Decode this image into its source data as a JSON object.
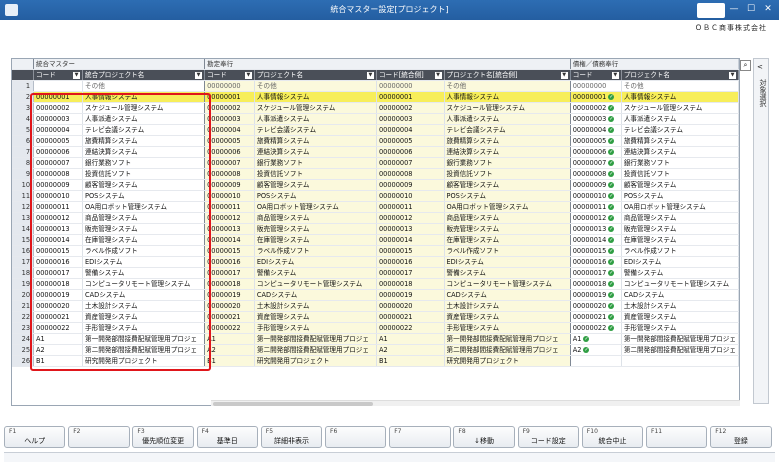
{
  "window": {
    "title": "統合マスター設定[プロジェクト]",
    "company": "ＯＢＣ商事株式会社",
    "min": "—",
    "max": "☐",
    "close": "✕"
  },
  "groups": {
    "g1": "統合マスター",
    "g2": "勘定奉行",
    "g3": "債権／債務奉行"
  },
  "headers": {
    "h1": "コード",
    "h2": "統合プロジェクト名",
    "h3": "コード",
    "h4": "プロジェクト名",
    "h5": "コード[統合側]",
    "h6": "プロジェクト名[統合側]",
    "h7": "コード",
    "h8": "プロジェクト名"
  },
  "side_panel": {
    "label": "対象選択",
    "chevron": "<"
  },
  "search_icon": "search-icon",
  "rows": [
    {
      "n": "1",
      "c": "",
      "name": "その他",
      "c2": "00000000",
      "n2": "その他",
      "c3": "00000000",
      "n3": "その他",
      "c4": "00000000",
      "n4": "その他"
    },
    {
      "n": "2",
      "c": "00000001",
      "name": "人事情報システム",
      "c2": "00000001",
      "n2": "人事情報システム",
      "c3": "00000001",
      "n3": "人事情報システム",
      "c4": "00000001",
      "n4": "人事情報システム"
    },
    {
      "n": "3",
      "c": "00000002",
      "name": "スケジュール管理システム",
      "c2": "00000002",
      "n2": "スケジュール管理システム",
      "c3": "00000002",
      "n3": "スケジュール管理システム",
      "c4": "00000002",
      "n4": "スケジュール管理システム"
    },
    {
      "n": "4",
      "c": "00000003",
      "name": "人事派遣システム",
      "c2": "00000003",
      "n2": "人事派遣システム",
      "c3": "00000003",
      "n3": "人事派遣システム",
      "c4": "00000003",
      "n4": "人事派遣システム"
    },
    {
      "n": "5",
      "c": "00000004",
      "name": "テレビ会議システム",
      "c2": "00000004",
      "n2": "テレビ会議システム",
      "c3": "00000004",
      "n3": "テレビ会議システム",
      "c4": "00000004",
      "n4": "テレビ会議システム"
    },
    {
      "n": "6",
      "c": "00000005",
      "name": "旅費精算システム",
      "c2": "00000005",
      "n2": "旅費精算システム",
      "c3": "00000005",
      "n3": "旅費精算システム",
      "c4": "00000005",
      "n4": "旅費精算システム"
    },
    {
      "n": "7",
      "c": "00000006",
      "name": "連結決算システム",
      "c2": "00000006",
      "n2": "連結決算システム",
      "c3": "00000006",
      "n3": "連結決算システム",
      "c4": "00000006",
      "n4": "連結決算システム"
    },
    {
      "n": "8",
      "c": "00000007",
      "name": "銀行業務ソフト",
      "c2": "00000007",
      "n2": "銀行業務ソフト",
      "c3": "00000007",
      "n3": "銀行業務ソフト",
      "c4": "00000007",
      "n4": "銀行業務ソフト"
    },
    {
      "n": "9",
      "c": "00000008",
      "name": "投資信託ソフト",
      "c2": "00000008",
      "n2": "投資信託ソフト",
      "c3": "00000008",
      "n3": "投資信託ソフト",
      "c4": "00000008",
      "n4": "投資信託ソフト"
    },
    {
      "n": "10",
      "c": "00000009",
      "name": "顧客管理システム",
      "c2": "00000009",
      "n2": "顧客管理システム",
      "c3": "00000009",
      "n3": "顧客管理システム",
      "c4": "00000009",
      "n4": "顧客管理システム"
    },
    {
      "n": "11",
      "c": "00000010",
      "name": "POSシステム",
      "c2": "00000010",
      "n2": "POSシステム",
      "c3": "00000010",
      "n3": "POSシステム",
      "c4": "00000010",
      "n4": "POSシステム"
    },
    {
      "n": "12",
      "c": "00000011",
      "name": "OA用ロボット管理システム",
      "c2": "00000011",
      "n2": "OA用ロボット管理システム",
      "c3": "00000011",
      "n3": "OA用ロボット管理システム",
      "c4": "00000011",
      "n4": "OA用ロボット管理システム"
    },
    {
      "n": "13",
      "c": "00000012",
      "name": "商品管理システム",
      "c2": "00000012",
      "n2": "商品管理システム",
      "c3": "00000012",
      "n3": "商品管理システム",
      "c4": "00000012",
      "n4": "商品管理システム"
    },
    {
      "n": "14",
      "c": "00000013",
      "name": "販売管理システム",
      "c2": "00000013",
      "n2": "販売管理システム",
      "c3": "00000013",
      "n3": "販売管理システム",
      "c4": "00000013",
      "n4": "販売管理システム"
    },
    {
      "n": "15",
      "c": "00000014",
      "name": "在庫管理システム",
      "c2": "00000014",
      "n2": "在庫管理システム",
      "c3": "00000014",
      "n3": "在庫管理システム",
      "c4": "00000014",
      "n4": "在庫管理システム"
    },
    {
      "n": "16",
      "c": "00000015",
      "name": "ラベル作成ソフト",
      "c2": "00000015",
      "n2": "ラベル作成ソフト",
      "c3": "00000015",
      "n3": "ラベル作成ソフト",
      "c4": "00000015",
      "n4": "ラベル作成ソフト"
    },
    {
      "n": "17",
      "c": "00000016",
      "name": "EDIシステム",
      "c2": "00000016",
      "n2": "EDIシステム",
      "c3": "00000016",
      "n3": "EDIシステム",
      "c4": "00000016",
      "n4": "EDIシステム"
    },
    {
      "n": "18",
      "c": "00000017",
      "name": "警備システム",
      "c2": "00000017",
      "n2": "警備システム",
      "c3": "00000017",
      "n3": "警備システム",
      "c4": "00000017",
      "n4": "警備システム"
    },
    {
      "n": "19",
      "c": "00000018",
      "name": "コンピュータリモート管理システム",
      "c2": "00000018",
      "n2": "コンピュータリモート管理システム",
      "c3": "00000018",
      "n3": "コンピュータリモート管理システム",
      "c4": "00000018",
      "n4": "コンピュータリモート管理システム"
    },
    {
      "n": "20",
      "c": "00000019",
      "name": "CADシステム",
      "c2": "00000019",
      "n2": "CADシステム",
      "c3": "00000019",
      "n3": "CADシステム",
      "c4": "00000019",
      "n4": "CADシステム"
    },
    {
      "n": "21",
      "c": "00000020",
      "name": "土木設計システム",
      "c2": "00000020",
      "n2": "土木設計システム",
      "c3": "00000020",
      "n3": "土木設計システム",
      "c4": "00000020",
      "n4": "土木設計システム"
    },
    {
      "n": "22",
      "c": "00000021",
      "name": "資産管理システム",
      "c2": "00000021",
      "n2": "資産管理システム",
      "c3": "00000021",
      "n3": "資産管理システム",
      "c4": "00000021",
      "n4": "資産管理システム"
    },
    {
      "n": "23",
      "c": "00000022",
      "name": "手形管理システム",
      "c2": "00000022",
      "n2": "手形管理システム",
      "c3": "00000022",
      "n3": "手形管理システム",
      "c4": "00000022",
      "n4": "手形管理システム"
    },
    {
      "n": "24",
      "c": "A1",
      "name": "第一開発部間接費配賦管理用プロジェ",
      "c2": "A1",
      "n2": "第一開発部間接費配賦管理用プロジェ",
      "c3": "A1",
      "n3": "第一開発部間接費配賦管理用プロジェ",
      "c4": "A1",
      "n4": "第一開発部間接費配賦管理用プロジェ"
    },
    {
      "n": "25",
      "c": "A2",
      "name": "第二開発部間接費配賦管理用プロジェ",
      "c2": "A2",
      "n2": "第二開発部間接費配賦管理用プロジェ",
      "c3": "A2",
      "n3": "第二開発部間接費配賦管理用プロジェ",
      "c4": "A2",
      "n4": "第二開発部間接費配賦管理用プロジェ"
    },
    {
      "n": "26",
      "c": "B1",
      "name": "研究開発用プロジェクト",
      "c2": "B1",
      "n2": "研究開発用プロジェクト",
      "c3": "B1",
      "n3": "研究開発用プロジェクト",
      "c4": "",
      "n4": ""
    }
  ],
  "fkeys": [
    {
      "n": "F1",
      "l": "ヘルプ"
    },
    {
      "n": "F2",
      "l": ""
    },
    {
      "n": "F3",
      "l": "優先順位変更"
    },
    {
      "n": "F4",
      "l": "基準日"
    },
    {
      "n": "F5",
      "l": "詳細非表示"
    },
    {
      "n": "F6",
      "l": ""
    },
    {
      "n": "F7",
      "l": ""
    },
    {
      "n": "F8",
      "l": "↓移動"
    },
    {
      "n": "F9",
      "l": "コード設定"
    },
    {
      "n": "F10",
      "l": "統合中止"
    },
    {
      "n": "F11",
      "l": ""
    },
    {
      "n": "F12",
      "l": "登録"
    }
  ]
}
